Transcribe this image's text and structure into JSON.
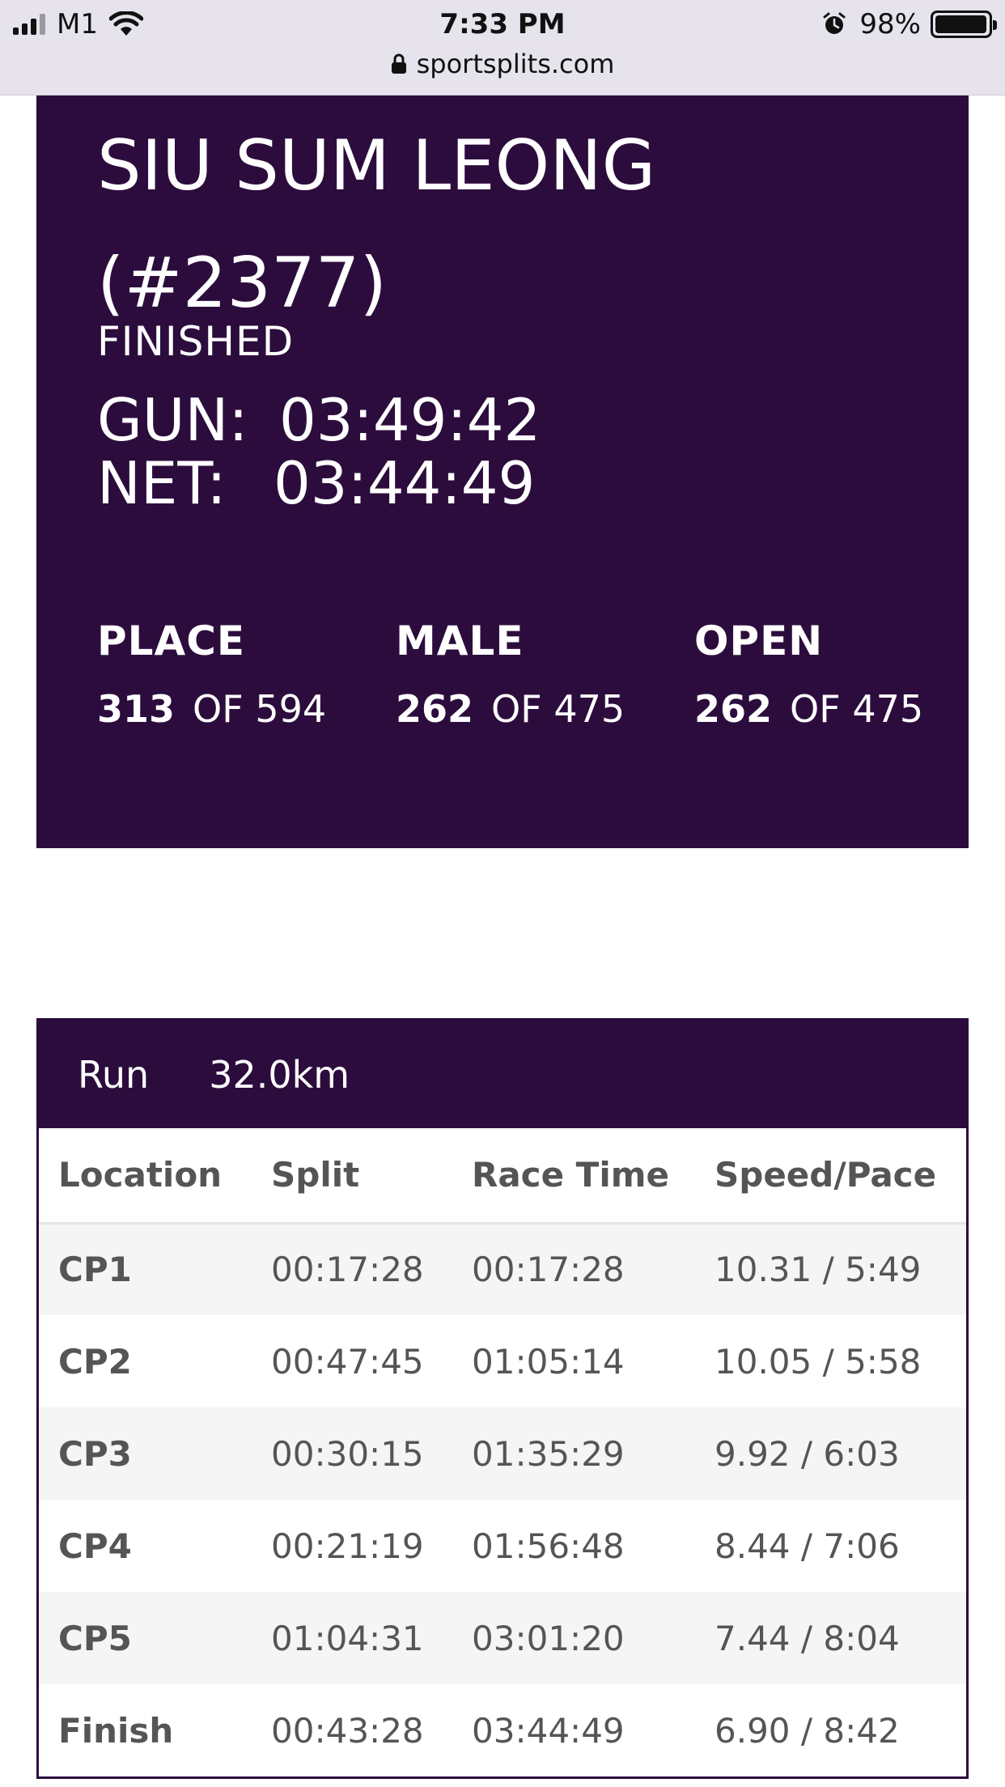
{
  "status_bar": {
    "carrier": "M1",
    "time": "7:33 PM",
    "battery": "98%",
    "battery_level": 0.98,
    "url": "sportsplits.com",
    "icons": [
      "signal-icon",
      "wifi-icon",
      "alarm-icon",
      "battery-icon",
      "lock-icon"
    ]
  },
  "athlete": {
    "name": "SIU SUM LEONG (#2377)",
    "status": "FINISHED",
    "gun_label": "GUN:",
    "gun_time": "03:49:42",
    "net_label": "NET:",
    "net_time": "03:44:49",
    "rankings": [
      {
        "title": "PLACE",
        "rank": "313",
        "of": "OF 594"
      },
      {
        "title": "MALE",
        "rank": "262",
        "of": "OF 475"
      },
      {
        "title": "OPEN",
        "rank": "262",
        "of": "OF 475"
      }
    ]
  },
  "splits": {
    "event": "Run",
    "distance": "32.0km",
    "columns": [
      "Location",
      "Split",
      "Race Time",
      "Speed/Pace"
    ],
    "rows": [
      {
        "location": "CP1",
        "split": "00:17:28",
        "race_time": "00:17:28",
        "speed_pace": "10.31 / 5:49"
      },
      {
        "location": "CP2",
        "split": "00:47:45",
        "race_time": "01:05:14",
        "speed_pace": "10.05 / 5:58"
      },
      {
        "location": "CP3",
        "split": "00:30:15",
        "race_time": "01:35:29",
        "speed_pace": "9.92 / 6:03"
      },
      {
        "location": "CP4",
        "split": "00:21:19",
        "race_time": "01:56:48",
        "speed_pace": "8.44 / 7:06"
      },
      {
        "location": "CP5",
        "split": "01:04:31",
        "race_time": "03:01:20",
        "speed_pace": "7.44 / 8:04"
      },
      {
        "location": "Finish",
        "split": "00:43:28",
        "race_time": "03:44:49",
        "speed_pace": "6.90 / 8:42"
      }
    ]
  },
  "colors": {
    "brand": "#2c0c3d",
    "status_bar_bg": "#e6e3ec",
    "table_text": "#555555",
    "row_stripe": "#f5f5f5"
  }
}
